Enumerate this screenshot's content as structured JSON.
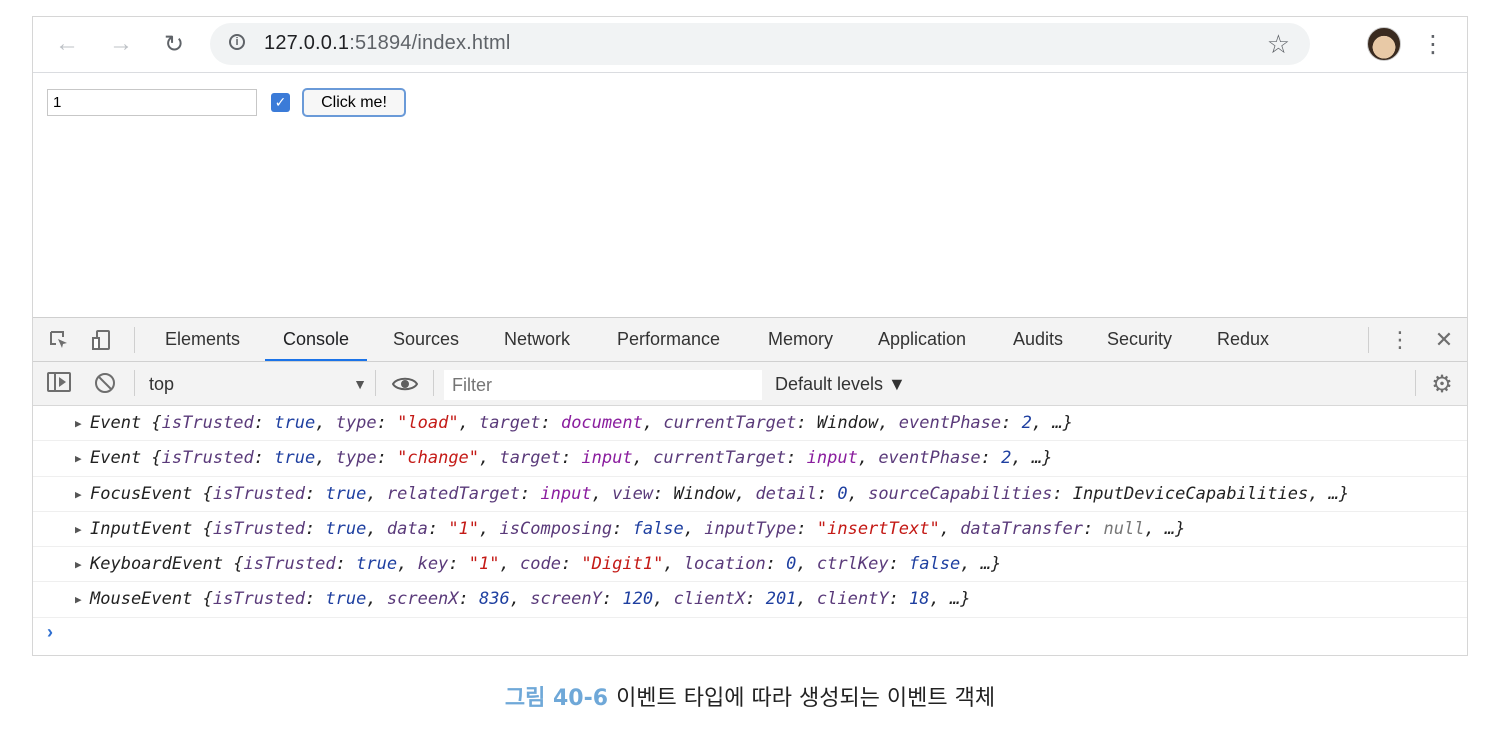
{
  "browser": {
    "url_host": "127.0.0.1",
    "url_rest": ":51894/index.html"
  },
  "page": {
    "text_value": "1",
    "checkbox_checked": true,
    "button_label": "Click me!"
  },
  "devtools": {
    "tabs": [
      {
        "label": "Elements",
        "active": false
      },
      {
        "label": "Console",
        "active": true
      },
      {
        "label": "Sources",
        "active": false
      },
      {
        "label": "Network",
        "active": false
      },
      {
        "label": "Performance",
        "active": false
      },
      {
        "label": "Memory",
        "active": false
      },
      {
        "label": "Application",
        "active": false
      },
      {
        "label": "Audits",
        "active": false
      },
      {
        "label": "Security",
        "active": false
      },
      {
        "label": "Redux",
        "active": false
      }
    ],
    "context": "top",
    "filter_placeholder": "Filter",
    "levels_label": "Default levels ▼"
  },
  "console": {
    "rows": [
      [
        [
          "Event {",
          "t"
        ],
        [
          "isTrusted",
          "k"
        ],
        [
          ": ",
          "t"
        ],
        [
          "true",
          "kb"
        ],
        [
          ", ",
          "t"
        ],
        [
          "type",
          "k"
        ],
        [
          ": ",
          "t"
        ],
        [
          "\"load\"",
          "ks"
        ],
        [
          ", ",
          "t"
        ],
        [
          "target",
          "k"
        ],
        [
          ": ",
          "t"
        ],
        [
          "document",
          "ko"
        ],
        [
          ", ",
          "t"
        ],
        [
          "currentTarget",
          "k"
        ],
        [
          ": ",
          "t"
        ],
        [
          "Window",
          "t"
        ],
        [
          ", ",
          "t"
        ],
        [
          "eventPhase",
          "k"
        ],
        [
          ": ",
          "t"
        ],
        [
          "2",
          "kn"
        ],
        [
          ", …}",
          "t"
        ]
      ],
      [
        [
          "Event {",
          "t"
        ],
        [
          "isTrusted",
          "k"
        ],
        [
          ": ",
          "t"
        ],
        [
          "true",
          "kb"
        ],
        [
          ", ",
          "t"
        ],
        [
          "type",
          "k"
        ],
        [
          ": ",
          "t"
        ],
        [
          "\"change\"",
          "ks"
        ],
        [
          ", ",
          "t"
        ],
        [
          "target",
          "k"
        ],
        [
          ": ",
          "t"
        ],
        [
          "input",
          "ko"
        ],
        [
          ", ",
          "t"
        ],
        [
          "currentTarget",
          "k"
        ],
        [
          ": ",
          "t"
        ],
        [
          "input",
          "ko"
        ],
        [
          ", ",
          "t"
        ],
        [
          "eventPhase",
          "k"
        ],
        [
          ": ",
          "t"
        ],
        [
          "2",
          "kn"
        ],
        [
          ", …}",
          "t"
        ]
      ],
      [
        [
          "FocusEvent {",
          "t"
        ],
        [
          "isTrusted",
          "k"
        ],
        [
          ": ",
          "t"
        ],
        [
          "true",
          "kb"
        ],
        [
          ", ",
          "t"
        ],
        [
          "relatedTarget",
          "k"
        ],
        [
          ": ",
          "t"
        ],
        [
          "input",
          "ko"
        ],
        [
          ", ",
          "t"
        ],
        [
          "view",
          "k"
        ],
        [
          ": ",
          "t"
        ],
        [
          "Window",
          "t"
        ],
        [
          ", ",
          "t"
        ],
        [
          "detail",
          "k"
        ],
        [
          ": ",
          "t"
        ],
        [
          "0",
          "kn"
        ],
        [
          ", ",
          "t"
        ],
        [
          "sourceCapabilities",
          "k"
        ],
        [
          ": ",
          "t"
        ],
        [
          "InputDeviceCapabilities",
          "t"
        ],
        [
          ", …}",
          "t"
        ]
      ],
      [
        [
          "InputEvent {",
          "t"
        ],
        [
          "isTrusted",
          "k"
        ],
        [
          ": ",
          "t"
        ],
        [
          "true",
          "kb"
        ],
        [
          ", ",
          "t"
        ],
        [
          "data",
          "k"
        ],
        [
          ": ",
          "t"
        ],
        [
          "\"1\"",
          "ks"
        ],
        [
          ", ",
          "t"
        ],
        [
          "isComposing",
          "k"
        ],
        [
          ": ",
          "t"
        ],
        [
          "false",
          "kb"
        ],
        [
          ", ",
          "t"
        ],
        [
          "inputType",
          "k"
        ],
        [
          ": ",
          "t"
        ],
        [
          "\"insertText\"",
          "ks"
        ],
        [
          ", ",
          "t"
        ],
        [
          "dataTransfer",
          "k"
        ],
        [
          ": ",
          "t"
        ],
        [
          "null",
          "kg"
        ],
        [
          ", …}",
          "t"
        ]
      ],
      [
        [
          "KeyboardEvent {",
          "t"
        ],
        [
          "isTrusted",
          "k"
        ],
        [
          ": ",
          "t"
        ],
        [
          "true",
          "kb"
        ],
        [
          ", ",
          "t"
        ],
        [
          "key",
          "k"
        ],
        [
          ": ",
          "t"
        ],
        [
          "\"1\"",
          "ks"
        ],
        [
          ", ",
          "t"
        ],
        [
          "code",
          "k"
        ],
        [
          ": ",
          "t"
        ],
        [
          "\"Digit1\"",
          "ks"
        ],
        [
          ", ",
          "t"
        ],
        [
          "location",
          "k"
        ],
        [
          ": ",
          "t"
        ],
        [
          "0",
          "kn"
        ],
        [
          ", ",
          "t"
        ],
        [
          "ctrlKey",
          "k"
        ],
        [
          ": ",
          "t"
        ],
        [
          "false",
          "kb"
        ],
        [
          ", …}",
          "t"
        ]
      ],
      [
        [
          "MouseEvent {",
          "t"
        ],
        [
          "isTrusted",
          "k"
        ],
        [
          ": ",
          "t"
        ],
        [
          "true",
          "kb"
        ],
        [
          ", ",
          "t"
        ],
        [
          "screenX",
          "k"
        ],
        [
          ": ",
          "t"
        ],
        [
          "836",
          "kn"
        ],
        [
          ", ",
          "t"
        ],
        [
          "screenY",
          "k"
        ],
        [
          ": ",
          "t"
        ],
        [
          "120",
          "kn"
        ],
        [
          ", ",
          "t"
        ],
        [
          "clientX",
          "k"
        ],
        [
          ": ",
          "t"
        ],
        [
          "201",
          "kn"
        ],
        [
          ", ",
          "t"
        ],
        [
          "clientY",
          "k"
        ],
        [
          ": ",
          "t"
        ],
        [
          "18",
          "kn"
        ],
        [
          ", …}",
          "t"
        ]
      ]
    ]
  },
  "caption": {
    "figure": "그림 40-6",
    "text": "이벤트 타입에 따라 생성되는 이벤트 객체"
  }
}
